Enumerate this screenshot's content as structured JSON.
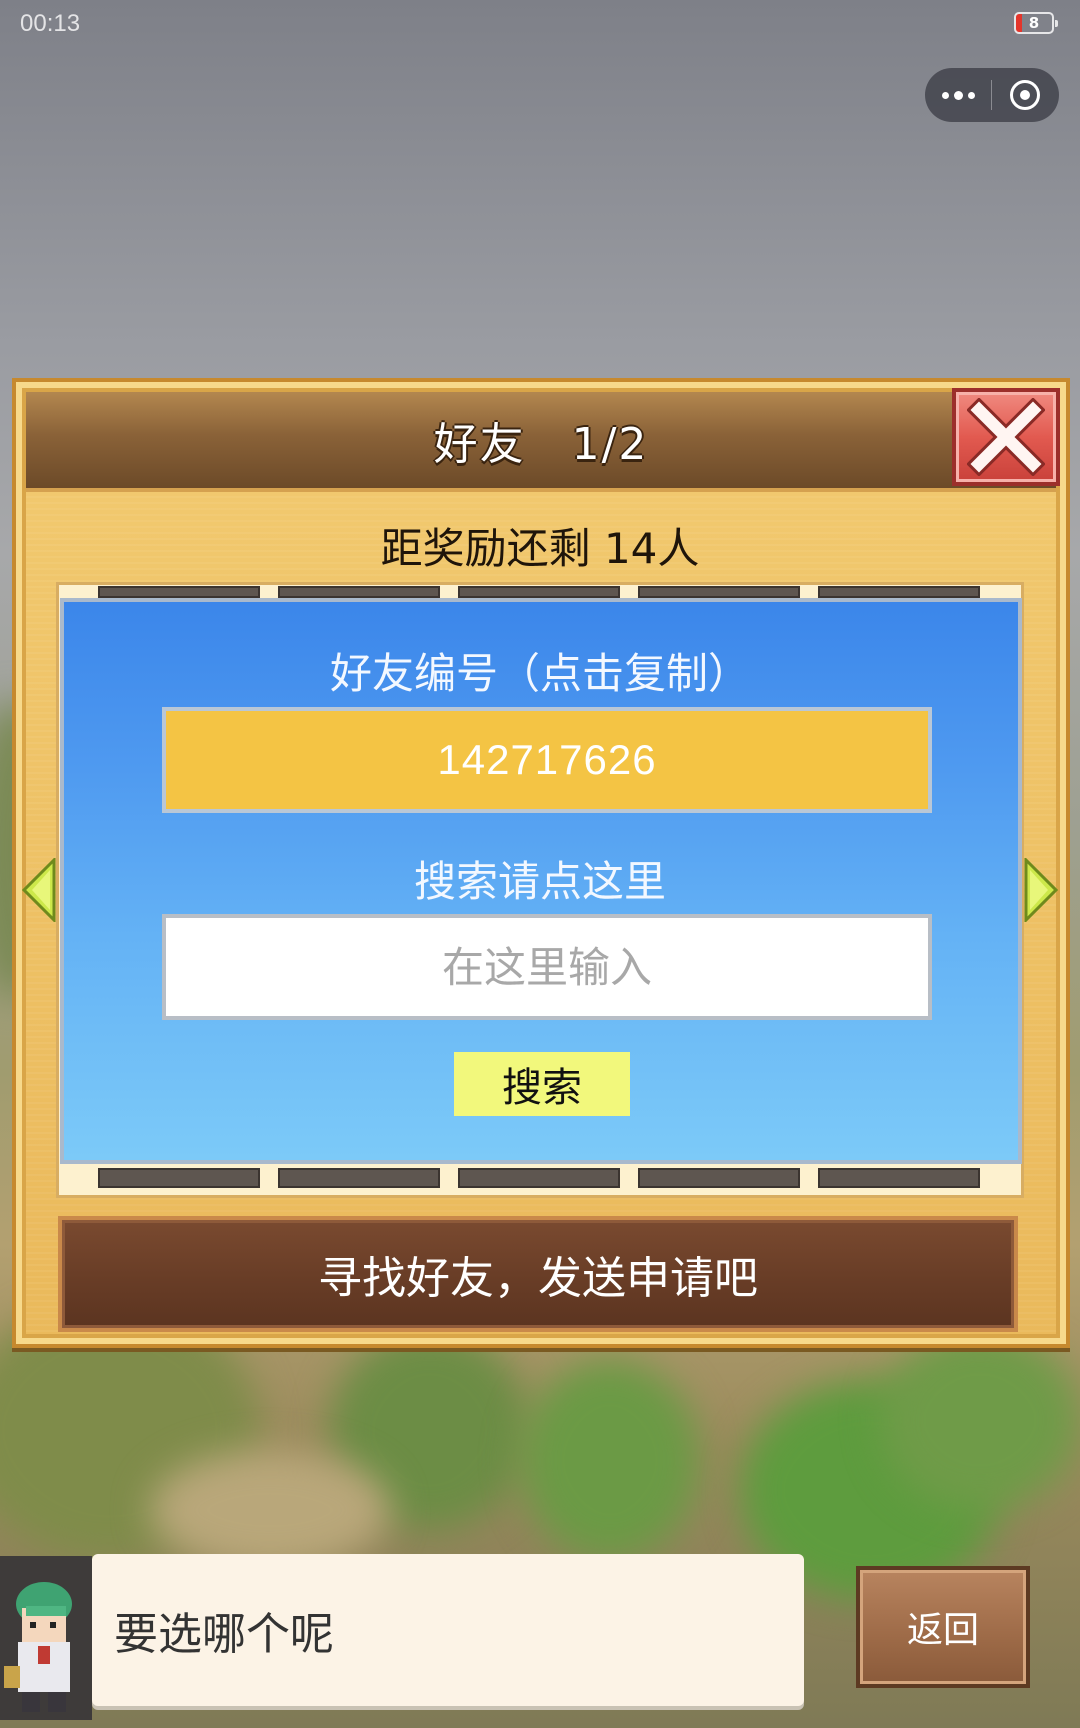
{
  "status_bar": {
    "time": "00:13",
    "battery": "8"
  },
  "dialog": {
    "title": "好友　1/2",
    "reward_text": "距奖励还剩 14人",
    "friend_id_label": "好友编号（点击复制）",
    "friend_id": "142717626",
    "search_label": "搜索请点这里",
    "search_placeholder": "在这里输入",
    "search_button": "搜索",
    "find_button": "寻找好友，发送申请吧"
  },
  "bottom": {
    "speech": "要选哪个呢",
    "back_button": "返回"
  },
  "colors": {
    "dialog_bg": "#efc467",
    "header_brown": "#8a6238",
    "close_red": "#e25a50",
    "panel_blue": "#4f9af0",
    "id_box_yellow": "#f4c444",
    "search_button_yellow": "#f2f87c",
    "find_button_brown": "#6a3e27"
  },
  "icons": {
    "close": "close-icon",
    "left_arrow": "left-arrow-icon",
    "right_arrow": "right-arrow-icon",
    "more": "more-dots-icon",
    "target": "target-icon"
  }
}
